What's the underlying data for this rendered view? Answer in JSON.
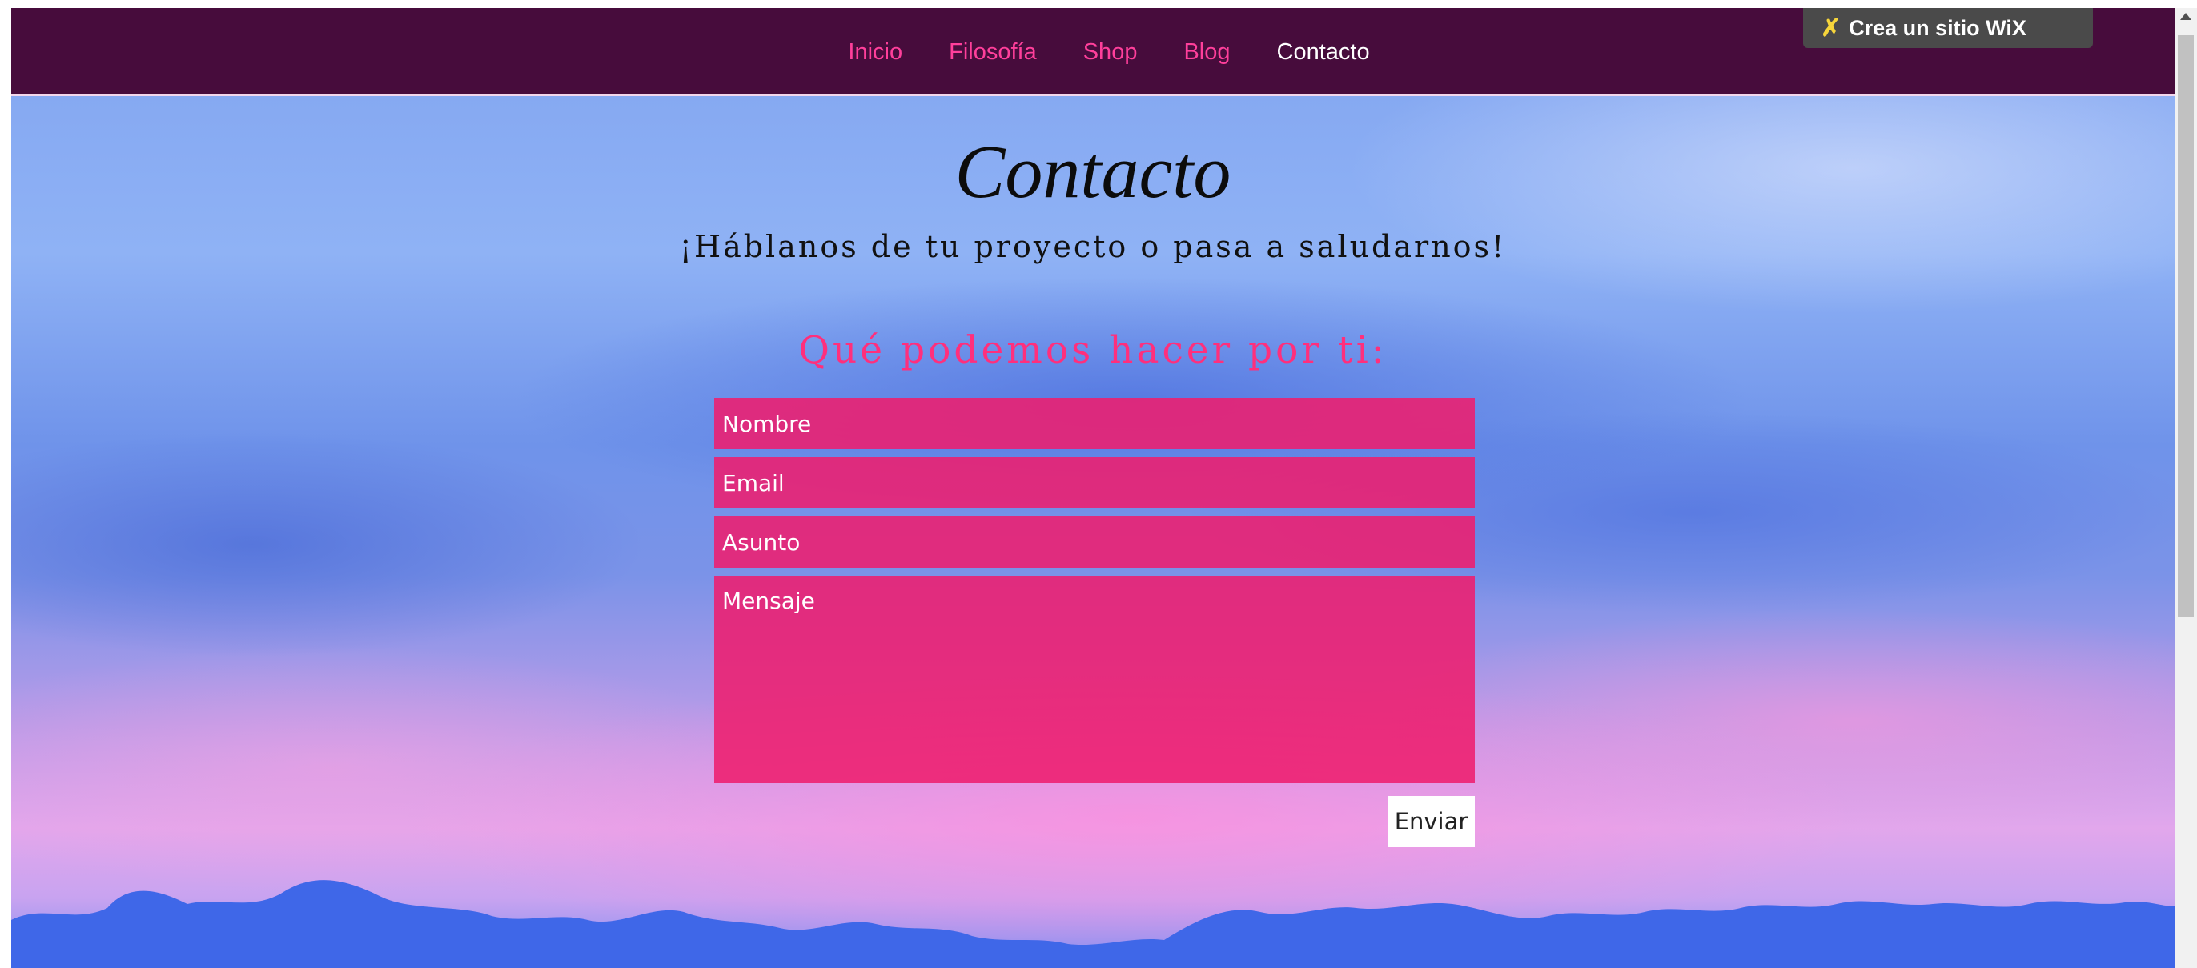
{
  "nav": {
    "items": [
      {
        "label": "Inicio"
      },
      {
        "label": "Filosofía"
      },
      {
        "label": "Shop"
      },
      {
        "label": "Blog"
      },
      {
        "label": "Contacto"
      }
    ],
    "active": "Contacto"
  },
  "wix_banner": {
    "label": "Crea un sitio WiX",
    "icon": "wix-x-icon"
  },
  "page": {
    "title": "Contacto",
    "subtitle": "¡Háblanos de tu proyecto o pasa a saludarnos!"
  },
  "form": {
    "heading": "Qué podemos hacer por ti:",
    "name_placeholder": "Nombre",
    "email_placeholder": "Email",
    "subject_placeholder": "Asunto",
    "message_placeholder": "Mensaje",
    "submit_label": "Enviar"
  },
  "colors": {
    "navbar": "#470c3c",
    "nav_link": "#ff3f9b",
    "nav_active": "#ffffff",
    "field_fill": "#ee1e6e",
    "heading_accent": "#ff2f7c"
  }
}
